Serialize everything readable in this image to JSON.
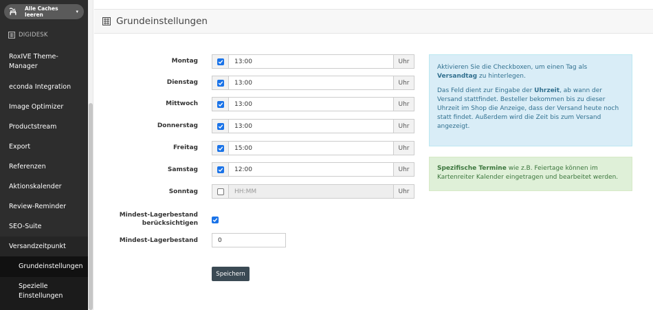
{
  "sidebar": {
    "cache_button": "Alle Caches leeren",
    "brand": "DIGIDESK",
    "items": [
      {
        "label": "RoxIVE Theme-Manager"
      },
      {
        "label": "econda Integration"
      },
      {
        "label": "Image Optimizer"
      },
      {
        "label": "Productstream"
      },
      {
        "label": "Export"
      },
      {
        "label": "Referenzen"
      },
      {
        "label": "Aktionskalender"
      },
      {
        "label": "Review-Reminder"
      },
      {
        "label": "SEO-Suite"
      },
      {
        "label": "Versandzeitpunkt"
      }
    ],
    "sub_items": [
      {
        "label": "Grundeinstellungen"
      },
      {
        "label": "Spezielle Einstellungen"
      }
    ]
  },
  "panel": {
    "title": "Grundeinstellungen"
  },
  "days": [
    {
      "label": "Montag",
      "checked": true,
      "value": "13:00",
      "unit": "Uhr"
    },
    {
      "label": "Dienstag",
      "checked": true,
      "value": "13:00",
      "unit": "Uhr"
    },
    {
      "label": "Mittwoch",
      "checked": true,
      "value": "13:00",
      "unit": "Uhr"
    },
    {
      "label": "Donnerstag",
      "checked": true,
      "value": "13:00",
      "unit": "Uhr"
    },
    {
      "label": "Freitag",
      "checked": true,
      "value": "15:00",
      "unit": "Uhr"
    },
    {
      "label": "Samstag",
      "checked": true,
      "value": "12:00",
      "unit": "Uhr"
    },
    {
      "label": "Sonntag",
      "checked": false,
      "value": "",
      "placeholder": "HH:MM",
      "unit": "Uhr"
    }
  ],
  "stock_check": {
    "label_line1": "Mindest-Lagerbestand",
    "label_line2": "berücksichtigen",
    "checked": true
  },
  "stock_min": {
    "label": "Mindest-Lagerbestand",
    "value": "0"
  },
  "save_label": "Speichern",
  "info": {
    "p1_a": "Aktivieren Sie die Checkboxen, um einen Tag als ",
    "p1_b": "Versandtag",
    "p1_c": " zu hinterlegen.",
    "p2_a": "Das Feld dient zur Eingabe der ",
    "p2_b": "Uhrzeit",
    "p2_c": ", ab wann der Versand stattfindet. Besteller bekommen bis zu dieser Uhrzeit im Shop die Anzeige, dass der Versand heute noch statt findet. Außerdem wird die Zeit bis zum Versand angezeigt."
  },
  "success": {
    "a": "Spezifische Termine",
    "b": " wie z.B. Feiertage können im Kartenreiter Kalender eingetragen und bearbeitet werden."
  },
  "colors": {
    "sidebar_bg": "#2d2d2d",
    "button_dark": "#3b4a54",
    "info_bg": "#d9edf7",
    "success_bg": "#dff0d8",
    "checkbox_blue": "#1a73e8"
  }
}
